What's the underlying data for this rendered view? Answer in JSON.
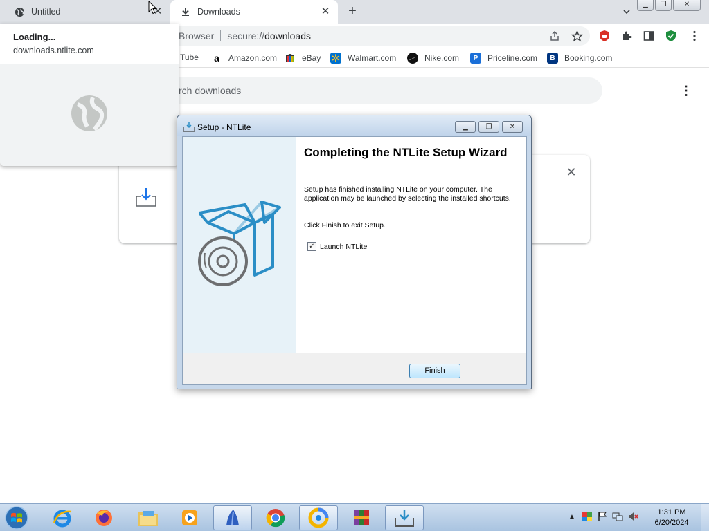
{
  "browser": {
    "tabs": [
      {
        "title": "Untitled",
        "icon": "globe-icon"
      },
      {
        "title": "Downloads",
        "icon": "download-icon"
      }
    ],
    "new_tab_label": "+",
    "close_glyph": "✕",
    "omnibox": {
      "label": "Browser",
      "url_prefix": "secure://",
      "url_path": "downloads"
    },
    "bookmarks": [
      {
        "label": "Tube",
        "icon": "youtube-icon"
      },
      {
        "label": "Amazon.com",
        "icon": "amazon-icon"
      },
      {
        "label": "eBay",
        "icon": "ebay-icon"
      },
      {
        "label": "Walmart.com",
        "icon": "walmart-icon"
      },
      {
        "label": "Nike.com",
        "icon": "nike-icon"
      },
      {
        "label": "Priceline.com",
        "icon": "priceline-icon",
        "badge": "P"
      },
      {
        "label": "Booking.com",
        "icon": "booking-icon",
        "badge": "B"
      }
    ]
  },
  "hover_card": {
    "title": "Loading...",
    "url": "downloads.ntlite.com"
  },
  "downloads_page": {
    "search_placeholder": "rch downloads",
    "menu_glyph": "⋮",
    "card_close": "✕"
  },
  "dialog": {
    "title": "Setup - NTLite",
    "heading": "Completing the NTLite Setup Wizard",
    "text1": "Setup has finished installing NTLite on your computer. The application may be launched by selecting the installed shortcuts.",
    "text2": "Click Finish to exit Setup.",
    "checkbox_label": "Launch NTLite",
    "checkbox_checked": true,
    "finish_label": "Finish"
  },
  "taskbar": {
    "apps": [
      "internet-explorer",
      "firefox",
      "file-explorer",
      "media-player",
      "app-blue",
      "chrome",
      "app-ring",
      "winrar",
      "setup-installer"
    ],
    "time": "1:31 PM",
    "date": "6/20/2024"
  },
  "colors": {
    "accent_blue": "#1a73e8",
    "dialog_side": "#e7f2f8",
    "box_blue": "#2b8ec6"
  }
}
